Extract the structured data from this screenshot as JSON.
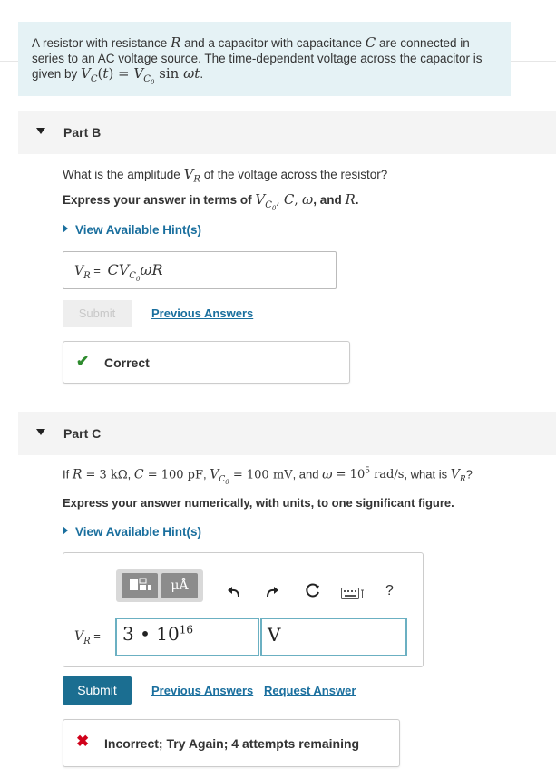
{
  "intro": {
    "text_1": "A resistor with resistance ",
    "sym_R": "R",
    "text_2": " and a capacitor with capacitance ",
    "sym_C": "C",
    "text_3": " are connected in series to an AC voltage source. The time-dependent voltage across the capacitor is given by ",
    "formula": "VC(t) = VC0 sin ωt",
    "text_4": "."
  },
  "part_b": {
    "title": "Part B",
    "question_1": "What is the amplitude ",
    "question_sym": "VR",
    "question_2": " of the voltage across the resistor?",
    "instruction_1": "Express your answer in terms of ",
    "instruction_syms": "VC0, C, ω, and R.",
    "hint_label": "View Available Hint(s)",
    "answer_label": "VR =",
    "answer_value": "CVC0ωR",
    "submit_label": "Submit",
    "previous_answers": "Previous Answers",
    "feedback_icon": "✔",
    "feedback_text": "Correct",
    "feedback_color": "#2e8b2e"
  },
  "part_c": {
    "title": "Part C",
    "question": "If R = 3 kΩ, C = 100 pF, VC0 = 100 mV, and ω = 105 rad/s, what is VR?",
    "instruction": "Express your answer numerically, with units, to one significant figure.",
    "hint_label": "View Available Hint(s)",
    "toolbar": {
      "templates_icon": "templates-icon",
      "units_icon": "units-icon",
      "units_label": "μÅ",
      "undo_icon": "undo-icon",
      "redo_icon": "redo-icon",
      "reset_icon": "reset-icon",
      "keyboard_icon": "keyboard-icon",
      "help_label": "?"
    },
    "answer_label": "VR =",
    "value_input": "3 • 1016",
    "unit_input": "V",
    "submit_label": "Submit",
    "previous_answers": "Previous Answers",
    "request_answer": "Request Answer",
    "feedback_icon": "✖",
    "feedback_text": "Incorrect; Try Again; 4 attempts remaining",
    "feedback_color": "#d0021b"
  },
  "colors": {
    "intro_bg": "#e5f2f5",
    "link": "#1a6f9e",
    "submit_bg": "#1b6e91"
  }
}
